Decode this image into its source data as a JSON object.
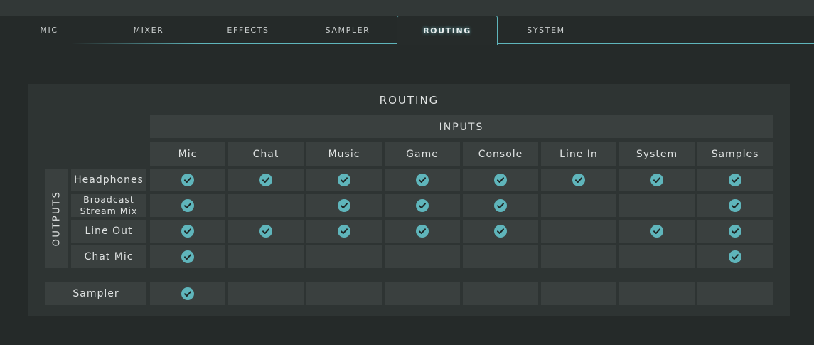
{
  "tabs": [
    {
      "label": "MIC",
      "active": false
    },
    {
      "label": "MIXER",
      "active": false
    },
    {
      "label": "EFFECTS",
      "active": false
    },
    {
      "label": "SAMPLER",
      "active": false
    },
    {
      "label": "ROUTING",
      "active": true
    },
    {
      "label": "SYSTEM",
      "active": false
    }
  ],
  "routing": {
    "title": "ROUTING",
    "inputs_label": "INPUTS",
    "outputs_label": "OUTPUTS",
    "inputs": [
      "Mic",
      "Chat",
      "Music",
      "Game",
      "Console",
      "Line In",
      "System",
      "Samples"
    ],
    "outputs": [
      {
        "name": "Headphones",
        "routes": [
          true,
          true,
          true,
          true,
          true,
          true,
          true,
          true
        ]
      },
      {
        "name": "Broadcast\nStream Mix",
        "routes": [
          true,
          false,
          true,
          true,
          true,
          false,
          false,
          true
        ]
      },
      {
        "name": "Line Out",
        "routes": [
          true,
          true,
          true,
          true,
          true,
          false,
          true,
          true
        ]
      },
      {
        "name": "Chat Mic",
        "routes": [
          true,
          false,
          false,
          false,
          false,
          false,
          false,
          true
        ]
      }
    ],
    "sampler": {
      "name": "Sampler",
      "routes": [
        true,
        false,
        false,
        false,
        false,
        false,
        false,
        false
      ]
    }
  },
  "colors": {
    "accent": "#5fb5bb",
    "background": "#252a29",
    "panel": "#2e3433",
    "cell": "#3a403f"
  },
  "icons": {
    "check": "check-circle-icon"
  }
}
